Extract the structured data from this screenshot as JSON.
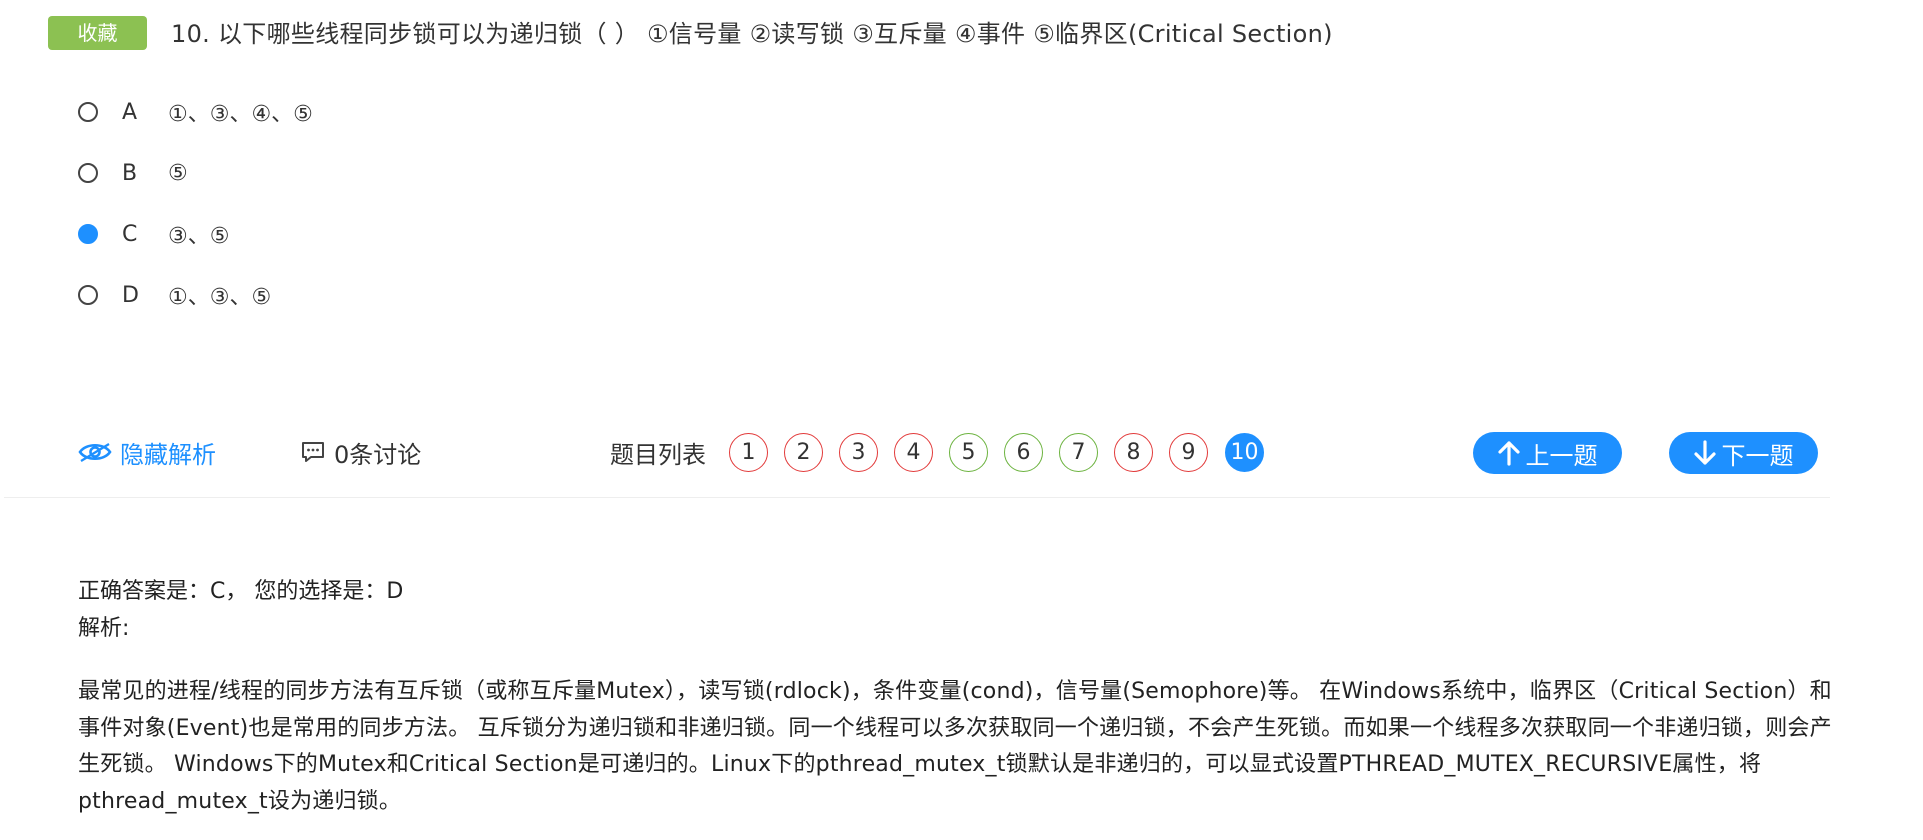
{
  "question": {
    "favorite_label": "收藏",
    "title": "10. 以下哪些线程同步锁可以为递归锁（ ） ①信号量 ②读写锁 ③互斥量 ④事件 ⑤临界区(Critical Section)",
    "options": [
      {
        "letter": "A",
        "text": "①、③、④、⑤",
        "selected": false
      },
      {
        "letter": "B",
        "text": "⑤",
        "selected": false
      },
      {
        "letter": "C",
        "text": "③、⑤",
        "selected": true
      },
      {
        "letter": "D",
        "text": "①、③、⑤",
        "selected": false
      }
    ]
  },
  "toolbar": {
    "hide_analysis_label": "隐藏解析",
    "discussion_label": "0条讨论",
    "question_list_label": "题目列表",
    "question_numbers": [
      {
        "num": "1",
        "status": "wrong"
      },
      {
        "num": "2",
        "status": "wrong"
      },
      {
        "num": "3",
        "status": "wrong"
      },
      {
        "num": "4",
        "status": "wrong"
      },
      {
        "num": "5",
        "status": "right"
      },
      {
        "num": "6",
        "status": "right"
      },
      {
        "num": "7",
        "status": "right"
      },
      {
        "num": "8",
        "status": "wrong"
      },
      {
        "num": "9",
        "status": "wrong"
      },
      {
        "num": "10",
        "status": "current"
      }
    ],
    "prev_label": "上一题",
    "next_label": "下一题"
  },
  "analysis": {
    "answer_line": "正确答案是：C， 您的选择是：D",
    "label": "解析:",
    "body": "最常见的进程/线程的同步方法有互斥锁（或称互斥量Mutex），读写锁(rdlock)，条件变量(cond)，信号量(Semophore)等。 在Windows系统中，临界区（Critical Section）和事件对象(Event)也是常用的同步方法。 互斥锁分为递归锁和非递归锁。同一个线程可以多次获取同一个递归锁，不会产生死锁。而如果一个线程多次获取同一个非递归锁，则会产生死锁。 Windows下的Mutex和Critical Section是可递归的。Linux下的pthread_mutex_t锁默认是非递归的，可以显式设置PTHREAD_MUTEX_RECURSIVE属性，将pthread_mutex_t设为递归锁。"
  },
  "colors": {
    "accent": "#1e90ff",
    "favorite_bg": "#8cc152",
    "wrong": "#e23a3a",
    "right": "#6cb33f"
  },
  "icons": {
    "hide_analysis": "eye-icon",
    "discussion": "comment-icon",
    "prev": "arrow-up-icon",
    "next": "arrow-down-icon"
  }
}
